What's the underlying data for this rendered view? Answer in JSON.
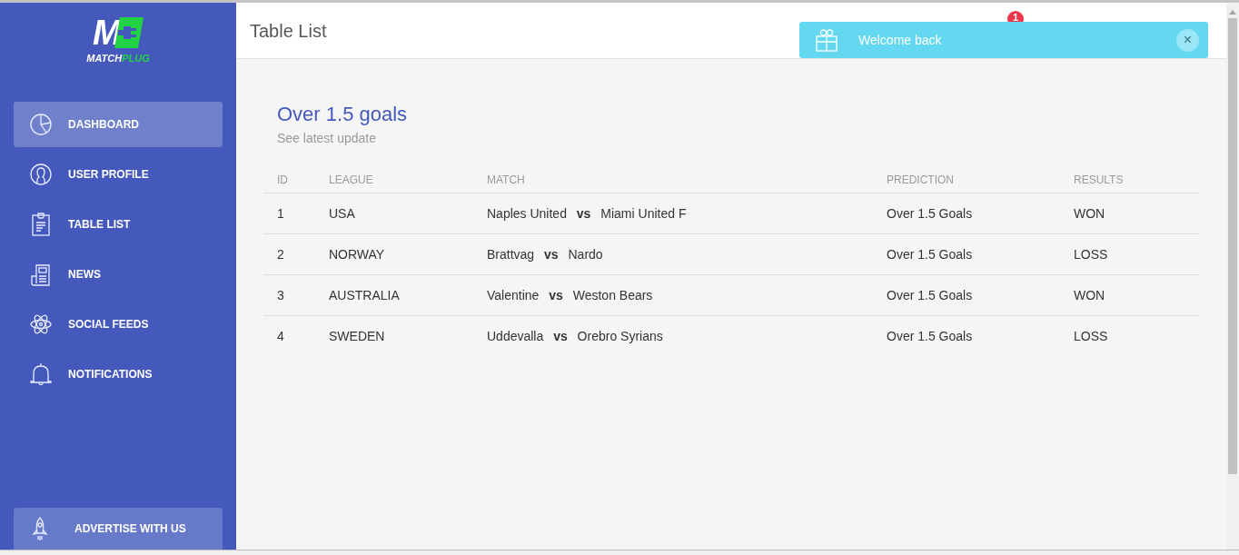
{
  "logo": {
    "mark": "M",
    "word_1": "MATCH",
    "word_2": "PLUG"
  },
  "sidebar": {
    "items": [
      {
        "label": "DASHBOARD",
        "selected": true
      },
      {
        "label": "USER PROFILE",
        "selected": false
      },
      {
        "label": "TABLE LIST",
        "selected": false
      },
      {
        "label": "NEWS",
        "selected": false
      },
      {
        "label": "SOCIAL FEEDS",
        "selected": false
      },
      {
        "label": "NOTIFICATIONS",
        "selected": false
      }
    ],
    "footer_button": "ADVERTISE WITH US"
  },
  "header": {
    "title": "Table List",
    "badge": "1"
  },
  "toast": {
    "message": "Welcome back",
    "close": "×"
  },
  "card": {
    "title": "Over 1.5 goals",
    "subtitle": "See latest update",
    "table": {
      "columns": [
        "ID",
        "LEAGUE",
        "MATCH",
        "PREDICTION",
        "RESULTS"
      ],
      "rows": [
        {
          "id": "1",
          "league": "USA",
          "match": "Naples United **vs** Miami United F",
          "prediction": "Over 1.5 Goals",
          "result": "WON"
        },
        {
          "id": "2",
          "league": "NORWAY",
          "match": "Brattvag **vs** Nardo",
          "prediction": "Over 1.5 Goals",
          "result": "LOSS"
        },
        {
          "id": "3",
          "league": "AUSTRALIA",
          "match": "Valentine **vs** Weston Bears",
          "prediction": "Over 1.5 Goals",
          "result": "WON"
        },
        {
          "id": "4",
          "league": "SWEDEN",
          "match": "Uddevalla **vs** Orebro Syrians",
          "prediction": "Over 1.5 Goals",
          "result": "LOSS"
        }
      ]
    }
  }
}
